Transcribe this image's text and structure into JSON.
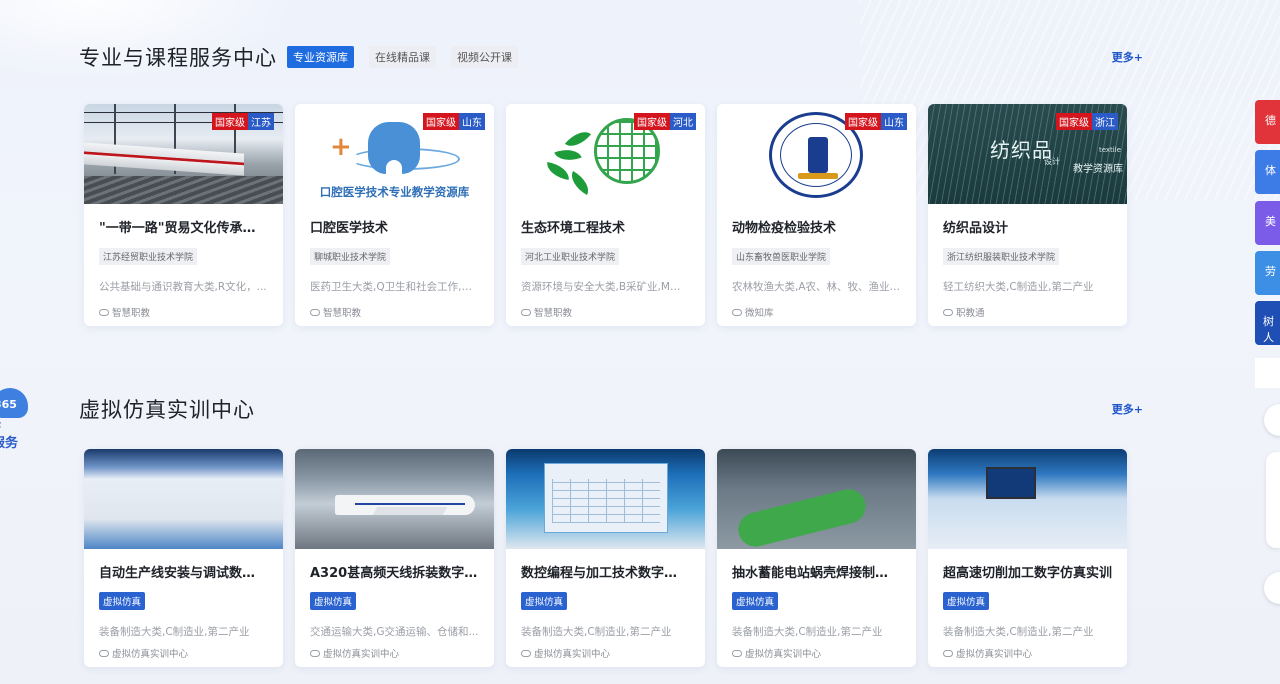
{
  "section1": {
    "title": "专业与课程服务中心",
    "tabs": [
      {
        "label": "专业资源库",
        "active": true
      },
      {
        "label": "在线精品课",
        "active": false
      },
      {
        "label": "视频公开课",
        "active": false
      }
    ],
    "more": "更多+",
    "cards": [
      {
        "level": "国家级",
        "province": "江苏",
        "title": "\"一带一路\"贸易文化传承与创新",
        "school": "江苏经贸职业技术学院",
        "category": "公共基础与通识教育大类,R文化，...",
        "source": "智慧职教"
      },
      {
        "level": "国家级",
        "province": "山东",
        "title": "口腔医学技术",
        "school": "聊城职业技术学院",
        "category": "医药卫生大类,Q卫生和社会工作,第...",
        "source": "智慧职教",
        "thumb_text": "口腔医学技术专业教学资源库"
      },
      {
        "level": "国家级",
        "province": "河北",
        "title": "生态环境工程技术",
        "school": "河北工业职业技术学院",
        "category": "资源环境与安全大类,B采矿业,M科...",
        "source": "智慧职教"
      },
      {
        "level": "国家级",
        "province": "山东",
        "title": "动物检疫检验技术",
        "school": "山东畜牧兽医职业学院",
        "category": "农林牧渔大类,A农、林、牧、渔业,...",
        "source": "微知库"
      },
      {
        "level": "国家级",
        "province": "浙江",
        "title": "纺织品设计",
        "school": "浙江纺织服装职业技术学院",
        "category": "轻工纺织大类,C制造业,第二产业",
        "source": "职教通",
        "thumb_text": {
          "main": "纺织品",
          "sub": "设计",
          "en": "textile",
          "lib": "教学资源库"
        }
      }
    ]
  },
  "section2": {
    "title": "虚拟仿真实训中心",
    "more": "更多+",
    "cards": [
      {
        "tag": "虚拟仿真",
        "title": "自动生产线安装与调试数字...",
        "category": "装备制造大类,C制造业,第二产业",
        "source": "虚拟仿真实训中心"
      },
      {
        "tag": "虚拟仿真",
        "title": "A320甚高频天线拆装数字仿...",
        "category": "交通运输大类,G交通运输、仓储和...",
        "source": "虚拟仿真实训中心"
      },
      {
        "tag": "虚拟仿真",
        "title": "数控编程与加工技术数字仿...",
        "category": "装备制造大类,C制造业,第二产业",
        "source": "虚拟仿真实训中心"
      },
      {
        "tag": "虚拟仿真",
        "title": "抽水蓄能电站蜗壳焊接制造...",
        "category": "装备制造大类,C制造业,第二产业",
        "source": "虚拟仿真实训中心"
      },
      {
        "tag": "虚拟仿真",
        "title": "超高速切削加工数字仿真实训",
        "category": "装备制造大类,C制造业,第二产业",
        "source": "虚拟仿真实训中心"
      }
    ]
  },
  "side_tabs": [
    {
      "label": "德",
      "color": "#e0343a"
    },
    {
      "label": "体",
      "color": "#3d7be6"
    },
    {
      "label": "美",
      "color": "#7a5ce8"
    },
    {
      "label": "劳",
      "color": "#3d8fe6"
    },
    {
      "label": "树人",
      "color": "#1f4fb4"
    }
  ],
  "float_logo": {
    "num": "365",
    "line1": "你",
    "line2": "服务"
  }
}
